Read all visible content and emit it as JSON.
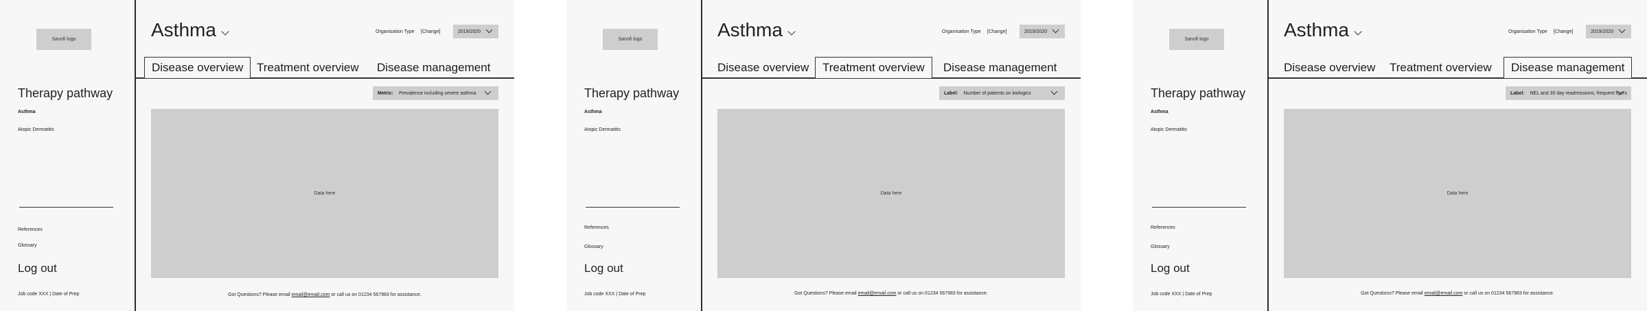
{
  "screens": [
    {
      "logo_text": "Sanofi logo",
      "sidebar": {
        "title": "Therapy pathway",
        "items": [
          {
            "label": "Asthma",
            "active": true
          },
          {
            "label": "Atopic Dermatitis",
            "active": false
          }
        ],
        "references": "References",
        "glossary": "Glossary",
        "logout": "Log out",
        "job_code": "Job code XXX | Date of Prep"
      },
      "header": {
        "title": "Asthma",
        "org_type_label": "Organisation Type",
        "change_link": "[Change]",
        "year_value": "2019/2020"
      },
      "tabs": [
        {
          "label": "Disease overview",
          "active": true
        },
        {
          "label": "Treatment overview",
          "active": false
        },
        {
          "label": "Disease management",
          "active": false
        }
      ],
      "filter": {
        "label": "Metric:",
        "value": "Prevalence including severe asthma"
      },
      "data_placeholder": "Data here",
      "footer": {
        "prefix": "Got Questions? Please email ",
        "email": "email@email.com",
        "suffix": " or call us on 01234 567983 for assistance."
      }
    },
    {
      "logo_text": "Sanofi logo",
      "sidebar": {
        "title": "Therapy pathway",
        "items": [
          {
            "label": "Asthma",
            "active": true
          },
          {
            "label": "Atopic Dermatitis",
            "active": false
          }
        ],
        "references": "References",
        "glossary": "Glossary",
        "logout": "Log out",
        "job_code": "Job code XXX | Date of Prep"
      },
      "header": {
        "title": "Asthma",
        "org_type_label": "Organisation Type",
        "change_link": "[Change]",
        "year_value": "2019/2020"
      },
      "tabs": [
        {
          "label": "Disease overview",
          "active": false
        },
        {
          "label": "Treatment overview",
          "active": true
        },
        {
          "label": "Disease management",
          "active": false
        }
      ],
      "filter": {
        "label": "Label:",
        "value": "Number of patients on biologics"
      },
      "data_placeholder": "Data here",
      "footer": {
        "prefix": "Got Questions? Please email ",
        "email": "email@email.com",
        "suffix": " or call us on 01234 567983 for assistance."
      }
    },
    {
      "logo_text": "Sanofi logo",
      "sidebar": {
        "title": "Therapy pathway",
        "items": [
          {
            "label": "Asthma",
            "active": true
          },
          {
            "label": "Atopic Dermatitis",
            "active": false
          }
        ],
        "references": "References",
        "glossary": "Glossary",
        "logout": "Log out",
        "job_code": "Job code XXX | Date of Prep"
      },
      "header": {
        "title": "Asthma",
        "org_type_label": "Organisation Type",
        "change_link": "[Change]",
        "year_value": "2019/2020"
      },
      "tabs": [
        {
          "label": "Disease overview",
          "active": false
        },
        {
          "label": "Treatment overview",
          "active": false
        },
        {
          "label": "Disease management",
          "active": true
        }
      ],
      "filter": {
        "label": "Label:",
        "value": "NEL and 30 day readmissions, frequent flyers"
      },
      "data_placeholder": "Data here",
      "footer": {
        "prefix": "Got Questions? Please email ",
        "email": "email@email.com",
        "suffix": " or call us on 01234 567983 for assistance."
      }
    }
  ]
}
